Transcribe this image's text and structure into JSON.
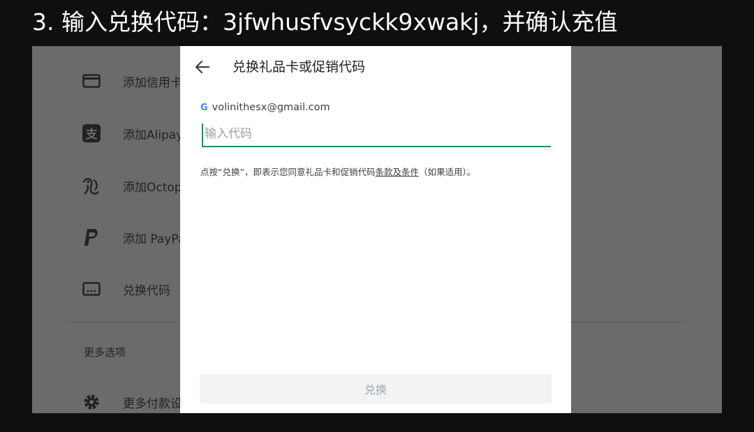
{
  "banner": {
    "text": "3. 输入兑换代码：3jfwhusfvsyckk9xwakj，并确认充值"
  },
  "background_menu": {
    "items": [
      {
        "icon": "credit-card-icon",
        "label": "添加信用卡"
      },
      {
        "icon": "alipay-icon",
        "label": "添加Alipay"
      },
      {
        "icon": "octopus-icon",
        "label": "添加Octopus"
      },
      {
        "icon": "paypal-icon",
        "label": "添加 PayPal"
      },
      {
        "icon": "redeem-code-icon",
        "label": "兑换代码"
      }
    ],
    "section_title": "更多选项",
    "more_items": [
      {
        "icon": "gear-icon",
        "label": "更多付款设置"
      }
    ]
  },
  "dialog": {
    "title": "兑换礼品卡或促销代码",
    "account_email": "volinithesx@gmail.com",
    "input": {
      "value": "",
      "placeholder": "输入代码"
    },
    "terms_prefix": "点按“兑换”，即表示您同意礼品卡和促销代码",
    "terms_link": "条款及条件",
    "terms_suffix": "（如果适用）。",
    "redeem_button": "兑换"
  },
  "colors": {
    "input_accent": "#1e8e6e",
    "google_blue": "#4285f4"
  }
}
